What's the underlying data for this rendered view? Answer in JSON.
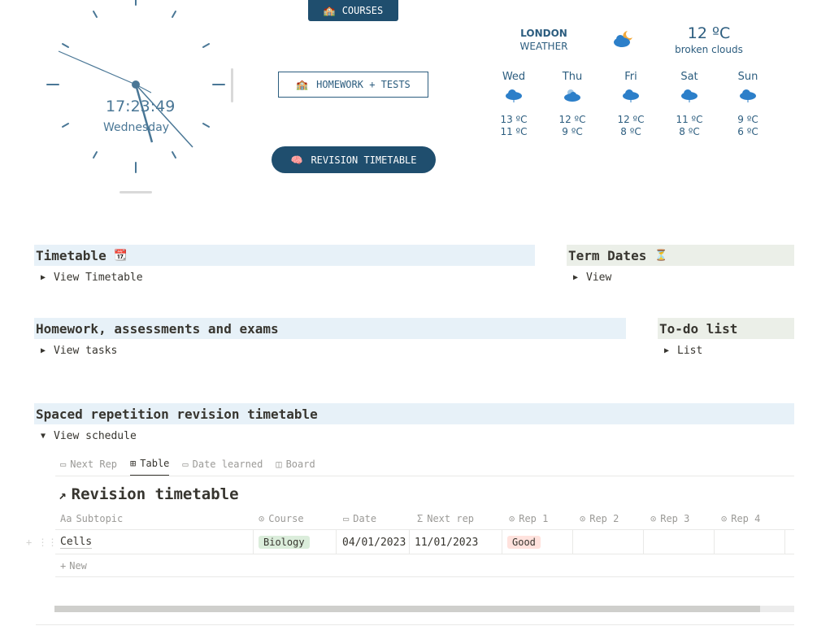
{
  "clock": {
    "time": "17:23:49",
    "day": "Wednesday"
  },
  "buttons": {
    "courses": {
      "icon": "🏫",
      "label": "COURSES"
    },
    "homework": {
      "icon": "🏫",
      "label": "HOMEWORK + TESTS"
    },
    "revision": {
      "icon": "🧠",
      "label": "REVISION TIMETABLE"
    }
  },
  "weather": {
    "city": "LONDON",
    "label": "WEATHER",
    "temp": "12 ºC",
    "desc": "broken clouds",
    "forecast": [
      {
        "day": "Wed",
        "hi": "13 ºC",
        "lo": "11 ºC",
        "icon": "cloud-rain-icon"
      },
      {
        "day": "Thu",
        "hi": "12 ºC",
        "lo": "9 ºC",
        "icon": "cloud-sun-icon"
      },
      {
        "day": "Fri",
        "hi": "12 ºC",
        "lo": "8 ºC",
        "icon": "cloud-rain-icon"
      },
      {
        "day": "Sat",
        "hi": "11 ºC",
        "lo": "8 ºC",
        "icon": "cloud-rain-icon"
      },
      {
        "day": "Sun",
        "hi": "9 ºC",
        "lo": "6 ºC",
        "icon": "cloud-rain-icon"
      }
    ],
    "color": "#2c5d7f"
  },
  "sections": {
    "timetable": {
      "title": "Timetable",
      "icon": "📆",
      "toggle": "View Timetable"
    },
    "term_dates": {
      "title": "Term Dates",
      "icon": "⏳",
      "toggle": "View"
    },
    "homework": {
      "title": "Homework, assessments and exams",
      "toggle": "View tasks"
    },
    "todo": {
      "title": "To-do list",
      "toggle": "List"
    },
    "spaced": {
      "title": "Spaced repetition revision timetable",
      "toggle": "View schedule"
    }
  },
  "views": {
    "tabs": [
      "Next Rep",
      "Table",
      "Date learned",
      "Board"
    ],
    "active": "Table"
  },
  "database": {
    "title": "Revision timetable",
    "columns": [
      {
        "prefix": "Aa",
        "label": "Subtopic"
      },
      {
        "prefix": "⊙",
        "label": "Course"
      },
      {
        "prefix": "▭",
        "label": "Date"
      },
      {
        "prefix": "Σ",
        "label": "Next rep"
      },
      {
        "prefix": "⊙",
        "label": "Rep 1"
      },
      {
        "prefix": "⊙",
        "label": "Rep 2"
      },
      {
        "prefix": "⊙",
        "label": "Rep 3"
      },
      {
        "prefix": "⊙",
        "label": "Rep 4"
      }
    ],
    "rows": [
      {
        "subtopic": "Cells",
        "course": "Biology",
        "date": "04/01/2023",
        "next_rep": "11/01/2023",
        "rep1": "Good"
      }
    ],
    "new_label": "New"
  }
}
